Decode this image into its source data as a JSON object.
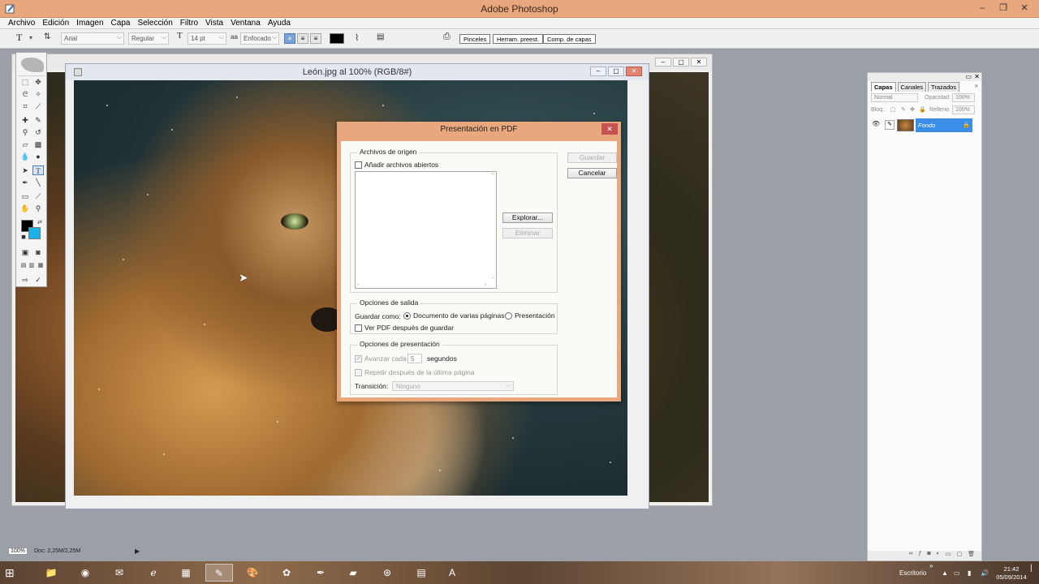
{
  "app": {
    "title": "Adobe Photoshop",
    "menu": [
      "Archivo",
      "Edición",
      "Imagen",
      "Capa",
      "Selección",
      "Filtro",
      "Vista",
      "Ventana",
      "Ayuda"
    ]
  },
  "options_bar": {
    "font_family": "Arial",
    "font_style": "Regular",
    "font_size": "14 pt",
    "antialias": "Enfocado",
    "text_color": "#000000",
    "palette_tabs": [
      "Pinceles",
      "Herram. preest.",
      "Comp. de capas"
    ]
  },
  "document": {
    "title": "León.jpg al 100% (RGB/8#)"
  },
  "tools": {
    "foreground_color": "#000000",
    "background_color": "#19b2e8"
  },
  "layers_panel": {
    "tabs": [
      "Capas",
      "Canales",
      "Trazados"
    ],
    "blend_mode": "Normal",
    "opacity_label": "Opacidad:",
    "opacity_value": "100%",
    "lock_label": "Bloq.:",
    "fill_label": "Relleno:",
    "fill_value": "100%",
    "layer_name": "Fondo"
  },
  "status": {
    "zoom": "100%",
    "doc_info": "Doc: 2,25M/2,25M"
  },
  "dialog": {
    "title": "Presentación en PDF",
    "source_group": "Archivos de origen",
    "add_open_files": "Añadir archivos abiertos",
    "browse_button": "Explorar...",
    "remove_button": "Eliminar",
    "save_button": "Guardar",
    "cancel_button": "Cancelar",
    "output_group": "Opciones de salida",
    "save_as_label": "Guardar como:",
    "save_as_multipage": "Documento de varias páginas",
    "save_as_presentation": "Presentación",
    "view_pdf": "Ver PDF después de guardar",
    "presentation_group": "Opciones de presentación",
    "advance_every": "Avanzar cada",
    "advance_value": "5",
    "seconds": "segundos",
    "repeat_after_last": "Repetir después de la última página",
    "transition_label": "Transición:",
    "transition_value": "Ninguno"
  },
  "taskbar": {
    "desktop_label": "Escritorio",
    "time": "21:42",
    "date": "05/09/2014"
  }
}
